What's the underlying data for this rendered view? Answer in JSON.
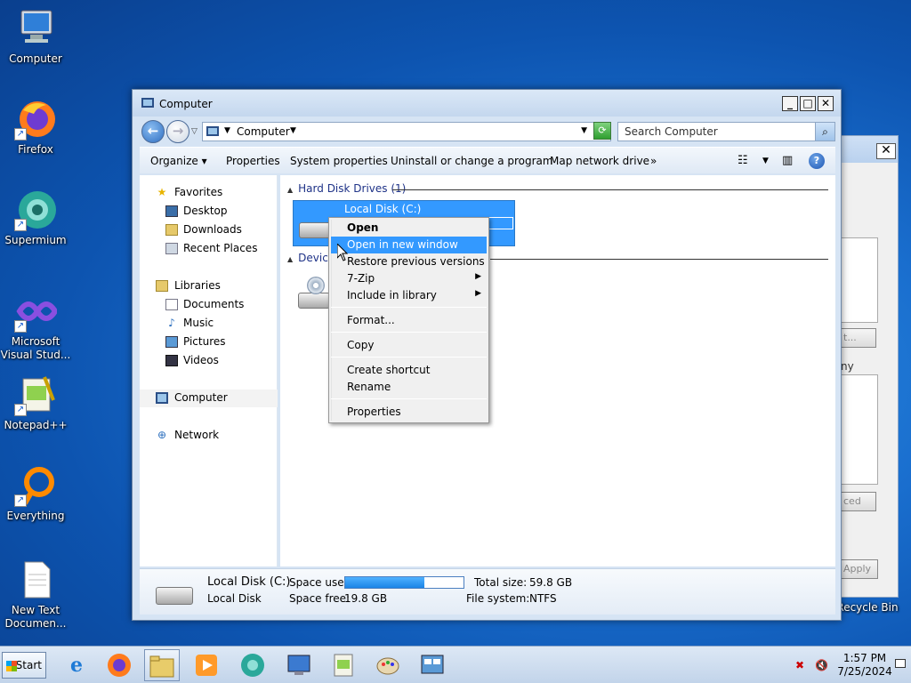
{
  "desktop": {
    "icons": [
      {
        "label": "Computer",
        "glyph": "🖥"
      },
      {
        "label": "Firefox",
        "glyph": "🦊"
      },
      {
        "label": "Supermium",
        "glyph": "◉"
      },
      {
        "label": "Microsoft Visual Stud...",
        "glyph": "∞"
      },
      {
        "label": "Notepad++",
        "glyph": "📝"
      },
      {
        "label": "Everything",
        "glyph": "○"
      },
      {
        "label": "New Text Documen...",
        "glyph": "📄"
      }
    ],
    "recycle_bin_label": "Recycle Bin"
  },
  "bg_dialog": {
    "close_label": "✕",
    "btn1_label": "t...",
    "label_ny": "ny",
    "btn2_label": "ced",
    "apply_label": "Apply"
  },
  "window": {
    "title": "Computer",
    "min_label": "_",
    "max_label": "□",
    "close_label": "✕",
    "address": {
      "text": "Computer"
    },
    "search": {
      "placeholder": "Search Computer"
    },
    "toolbar": {
      "organize": "Organize ▾",
      "properties": "Properties",
      "system_properties": "System properties",
      "uninstall": "Uninstall or change a program",
      "map_drive": "Map network drive",
      "more": "»"
    },
    "navpane": {
      "favorites": "Favorites",
      "desktop": "Desktop",
      "downloads": "Downloads",
      "recent_places": "Recent Places",
      "libraries": "Libraries",
      "documents": "Documents",
      "music": "Music",
      "pictures": "Pictures",
      "videos": "Videos",
      "computer": "Computer",
      "network": "Network"
    },
    "content": {
      "group_hdd": "Hard Disk Drives (1)",
      "group_devices": "Devic",
      "drive_name": "Local Disk (C:)"
    },
    "details": {
      "name": "Local Disk (C:)",
      "type": "Local Disk",
      "space_used_label": "Space used:",
      "space_free_label": "Space free:",
      "space_free_value": "19.8 GB",
      "total_size_label": "Total size:",
      "total_size_value": "59.8 GB",
      "file_system_label": "File system:",
      "file_system_value": "NTFS",
      "used_fraction": 0.67
    }
  },
  "context_menu": {
    "open": "Open",
    "open_new_window": "Open in new window",
    "restore": "Restore previous versions",
    "zip": "7-Zip",
    "include_library": "Include in library",
    "format": "Format...",
    "copy": "Copy",
    "create_shortcut": "Create shortcut",
    "rename": "Rename",
    "properties": "Properties"
  },
  "taskbar": {
    "start_label": "Start",
    "time": "1:57 PM",
    "date": "7/25/2024"
  }
}
